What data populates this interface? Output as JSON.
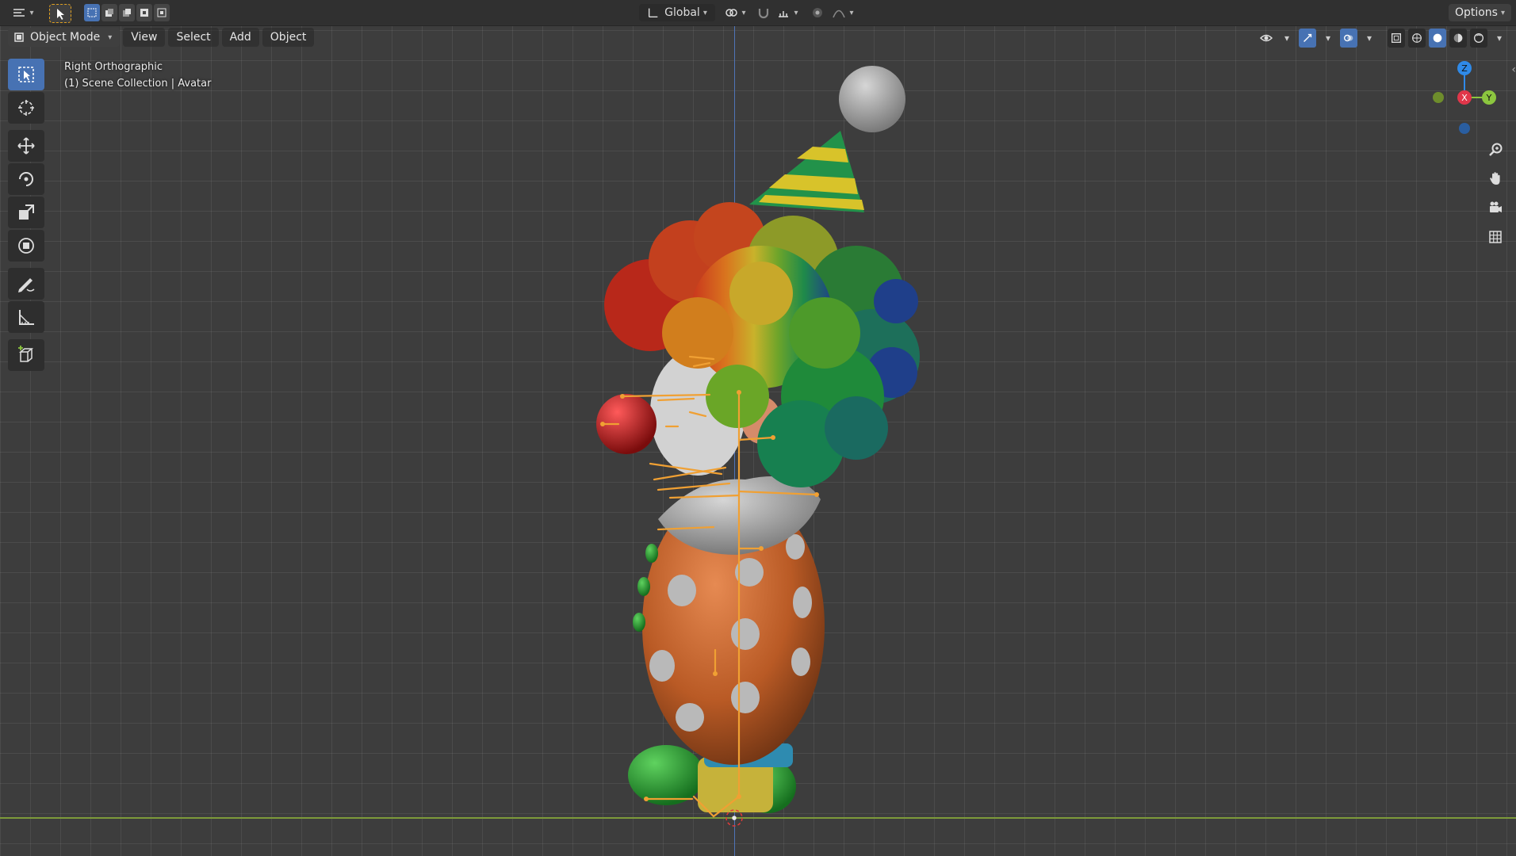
{
  "header": {
    "transform_orientation": "Global",
    "options_label": "Options"
  },
  "menubar": {
    "mode": "Object Mode",
    "items": [
      "View",
      "Select",
      "Add",
      "Object"
    ]
  },
  "overlay": {
    "view_name": "Right Orthographic",
    "collection": "(1) Scene Collection | Avatar"
  },
  "gizmo": {
    "z_label": "Z",
    "x_label": "X",
    "y_label": "Y"
  },
  "colors": {
    "accent": "#4772b3",
    "armature": "#f0a033",
    "axis_x": "#e0364a",
    "axis_y": "#8cc63f",
    "axis_z": "#2f8ae8"
  }
}
